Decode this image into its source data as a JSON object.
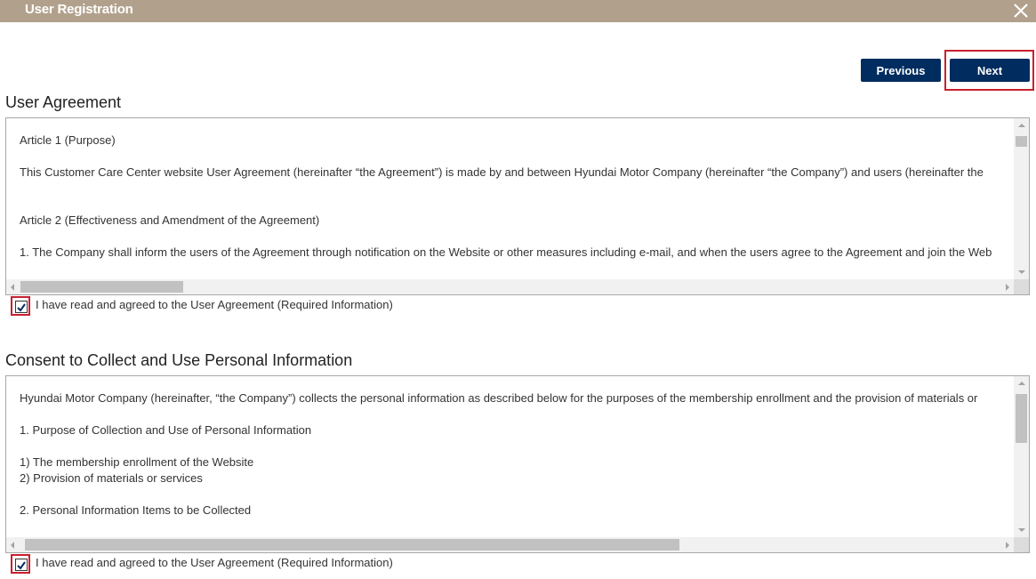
{
  "window": {
    "title": "User Registration",
    "close_icon": "close-icon"
  },
  "buttons": {
    "previous": "Previous",
    "next": "Next"
  },
  "agreement": {
    "title": "User Agreement",
    "paragraphs": [
      "Article 1 (Purpose)",
      "This Customer Care Center website User Agreement (hereinafter “the Agreement”) is made by and between Hyundai Motor Company (hereinafter “the Company”) and users (hereinafter the",
      "Article 2 (Effectiveness and Amendment of the Agreement)",
      "1. The Company shall inform the users of the Agreement through notification on the Website or other measures including e-mail, and when the users agree to the Agreement and join the Web"
    ],
    "checkbox_label": "I have read and agreed to the User Agreement (Required Information)",
    "checked": true
  },
  "consent": {
    "title": "Consent to Collect and Use Personal Information",
    "paragraphs": [
      "Hyundai Motor Company (hereinafter, “the Company”) collects the personal information as described below for the purposes of the membership enrollment and the provision of materials or",
      "1. Purpose of Collection and Use of Personal Information",
      "1) The membership enrollment of the Website",
      "2) Provision of materials or services",
      "2. Personal Information Items to be Collected"
    ],
    "checkbox_label": "I have read and agreed to the User Agreement (Required Information)",
    "checked": true
  },
  "colors": {
    "header": "#b1a18c",
    "button": "#002c5f",
    "highlight": "#c8202f"
  }
}
